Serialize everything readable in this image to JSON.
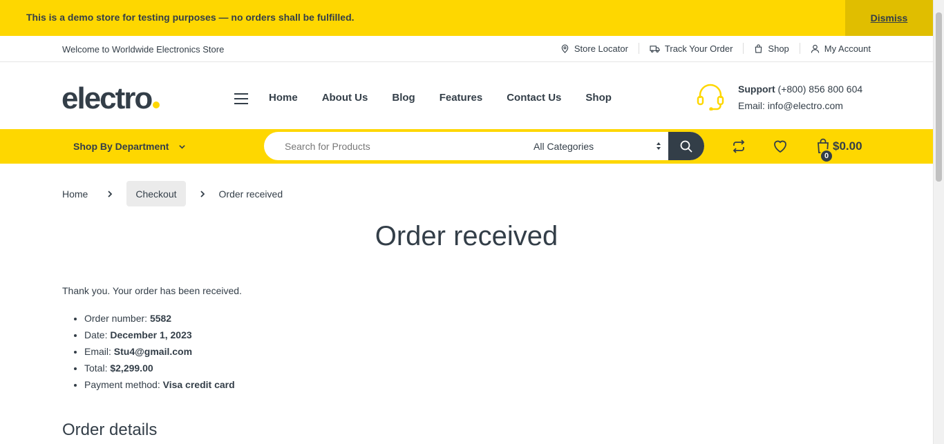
{
  "demo_notice": {
    "text": "This is a demo store for testing purposes — no orders shall be fulfilled.",
    "dismiss_label": "Dismiss"
  },
  "topbar": {
    "welcome": "Welcome to Worldwide Electronics Store",
    "links": [
      {
        "label": "Store Locator",
        "icon": "map-pin-icon"
      },
      {
        "label": "Track Your Order",
        "icon": "truck-icon"
      },
      {
        "label": "Shop",
        "icon": "shopping-bag-icon"
      },
      {
        "label": "My Account",
        "icon": "user-icon"
      }
    ]
  },
  "header": {
    "logo_text": "electro",
    "nav": [
      "Home",
      "About Us",
      "Blog",
      "Features",
      "Contact Us",
      "Shop"
    ],
    "support": {
      "label": "Support",
      "phone": "(+800) 856 800 604",
      "email": "Email: info@electro.com"
    }
  },
  "navbar": {
    "department_label": "Shop By Department",
    "search_placeholder": "Search for Products",
    "category_selected": "All Categories",
    "cart_count": "0",
    "cart_total": "$0.00"
  },
  "breadcrumb": {
    "home": "Home",
    "checkout": "Checkout",
    "current": "Order received"
  },
  "order": {
    "title": "Order received",
    "thanks": "Thank you. Your order has been received.",
    "overview": [
      {
        "label": "Order number:",
        "value": "5582"
      },
      {
        "label": "Date:",
        "value": "December 1, 2023"
      },
      {
        "label": "Email:",
        "value": "Stu4@gmail.com"
      },
      {
        "label": "Total:",
        "value": "$2,299.00"
      },
      {
        "label": "Payment method:",
        "value": "Visa credit card"
      }
    ],
    "details_title": "Order details"
  },
  "colors": {
    "accent": "#fed700",
    "dark": "#333e48"
  }
}
